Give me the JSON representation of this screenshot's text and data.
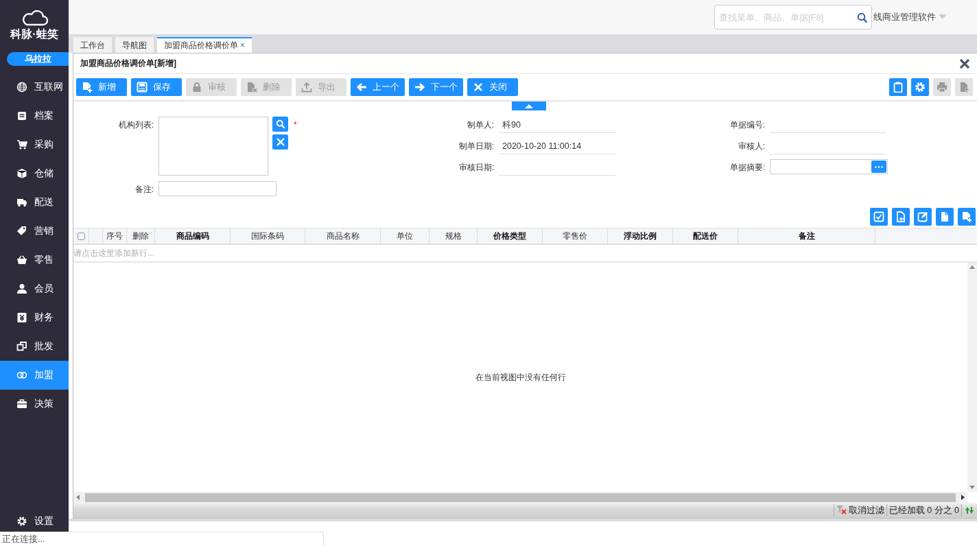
{
  "sidebar": {
    "brand": "科脉·蛙笑",
    "user": "乌拉拉",
    "items": [
      {
        "label": "互联网",
        "selected": false
      },
      {
        "label": "档案",
        "selected": false
      },
      {
        "label": "采购",
        "selected": false
      },
      {
        "label": "仓储",
        "selected": false
      },
      {
        "label": "配送",
        "selected": false
      },
      {
        "label": "营销",
        "selected": false
      },
      {
        "label": "零售",
        "selected": false
      },
      {
        "label": "会员",
        "selected": false
      },
      {
        "label": "财务",
        "selected": false
      },
      {
        "label": "批发",
        "selected": false
      },
      {
        "label": "加盟",
        "selected": true
      },
      {
        "label": "决策",
        "selected": false
      }
    ],
    "settings": "设置"
  },
  "topbar": {
    "search": {
      "placeholder": "查找菜单、商品、单据[F8]"
    },
    "product": "线商业管理软件"
  },
  "tabs": [
    {
      "label": "工作台",
      "selected": false,
      "closable": false
    },
    {
      "label": "导航图",
      "selected": false,
      "closable": false
    },
    {
      "label": "加盟商品价格调价单",
      "selected": true,
      "closable": true,
      "close": "×"
    }
  ],
  "panel": {
    "title": "加盟商品价格调价单[新增]",
    "toolbar": [
      {
        "label": "新增",
        "disabled": false
      },
      {
        "label": "保存",
        "disabled": false
      },
      {
        "label": "审核",
        "disabled": true
      },
      {
        "label": "删除",
        "disabled": true
      },
      {
        "label": "导出",
        "disabled": true
      },
      {
        "label": "上一个",
        "disabled": false
      },
      {
        "label": "下一个",
        "disabled": false
      },
      {
        "label": "关闭",
        "disabled": false
      }
    ],
    "tool_buttons": [
      {
        "disabled": false
      },
      {
        "disabled": false
      },
      {
        "disabled": true
      },
      {
        "disabled": true
      }
    ],
    "form": {
      "org_list": {
        "label": "机构列表:",
        "required": true,
        "required_mark": "*"
      },
      "remark": {
        "label": "备注:"
      },
      "column_2": [
        {
          "label": "制单人:",
          "value": "科90",
          "kind": "line"
        },
        {
          "label": "制单日期:",
          "value": "2020-10-20 11:00:14",
          "kind": "line"
        },
        {
          "label": "审核日期:",
          "kind": "line"
        }
      ],
      "column_3": [
        {
          "label": "单据编号:",
          "kind": "line"
        },
        {
          "label": "审核人:",
          "kind": "line"
        },
        {
          "label": "单据摘要:",
          "kind": "picker"
        }
      ]
    },
    "table": {
      "select_all": {
        "checked": false
      },
      "columns": [
        {
          "label": "序号",
          "bold": false
        },
        {
          "label": "删除",
          "bold": false
        },
        {
          "label": "商品编码",
          "bold": true
        },
        {
          "label": "国际条码",
          "bold": false
        },
        {
          "label": "商品名称",
          "bold": false
        },
        {
          "label": "单位",
          "bold": false
        },
        {
          "label": "规格",
          "bold": false
        },
        {
          "label": "价格类型",
          "bold": true
        },
        {
          "label": "零售价",
          "bold": false
        },
        {
          "label": "浮动比例",
          "bold": true
        },
        {
          "label": "配送价",
          "bold": true
        },
        {
          "label": "备注",
          "bold": true
        }
      ],
      "add_row": "请点击这里添加新行...",
      "empty_message": "在当前视图中没有任何行",
      "footer": {
        "clear_filter": "取消过滤",
        "loaded": "已经加载 0 分之 0"
      }
    }
  },
  "status": "正在连接..."
}
